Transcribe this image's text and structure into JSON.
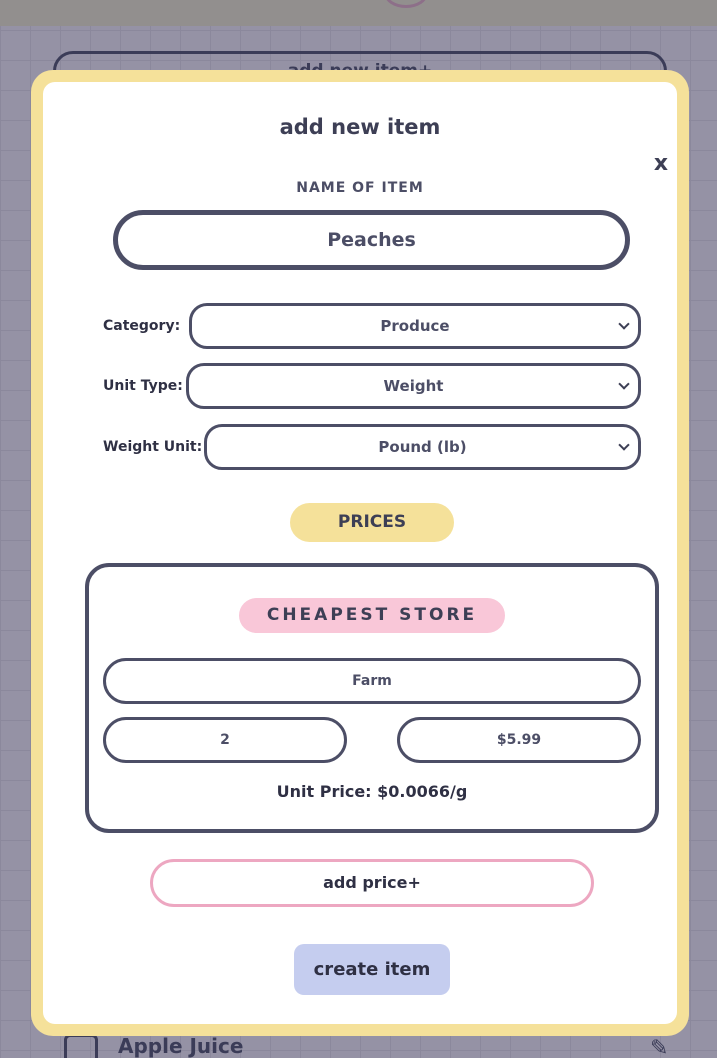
{
  "background": {
    "add_button_label": "add new item+",
    "list_item_label": "Apple Juice",
    "edit_icon": "pencil-icon"
  },
  "modal": {
    "title": "add new item",
    "close_label": "x",
    "name_label": "NAME OF ITEM",
    "name_value": "Peaches",
    "category_label": "Category:",
    "category_value": "Produce",
    "unit_type_label": "Unit Type:",
    "unit_type_value": "Weight",
    "weight_unit_label": "Weight Unit:",
    "weight_unit_value": "Pound (lb)",
    "prices_label": "PRICES",
    "price_card": {
      "badge": "CHEAPEST STORE",
      "store": "Farm",
      "quantity": "2",
      "price": "$5.99",
      "unit_price": "Unit Price: $0.0066/g"
    },
    "add_price_label": "add price+",
    "create_label": "create item"
  },
  "colors": {
    "modal_border": "#f5e19a",
    "accent_pink": "#f9c7d8",
    "create_button": "#c5cdef",
    "outline": "#4c4e66"
  }
}
